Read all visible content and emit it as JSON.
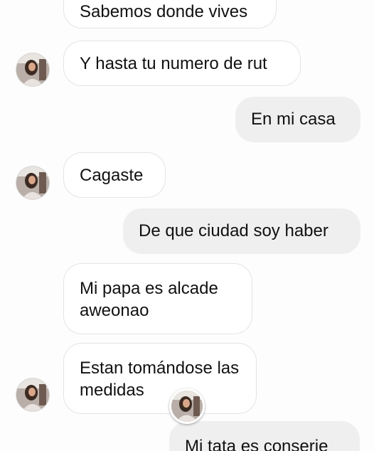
{
  "messages": [
    {
      "text": "Sabemos donde vives"
    },
    {
      "text": "Y hasta tu numero de rut"
    },
    {
      "text": "En mi casa"
    },
    {
      "text": "Cagaste"
    },
    {
      "text": "De que ciudad soy haber"
    },
    {
      "lines": [
        "Mi papa es alcade",
        "aweonao"
      ]
    },
    {
      "lines": [
        "Estan tomándose las",
        "medidas"
      ]
    },
    {
      "text": "Mi tata es conserje"
    }
  ],
  "colors": {
    "incoming_bubble": "#ffffff",
    "outgoing_bubble": "#efefef",
    "text": "#111111"
  },
  "icons": {
    "contact_avatar": "profile-photo-icon",
    "seen_indicator": "seen-avatar-icon"
  }
}
